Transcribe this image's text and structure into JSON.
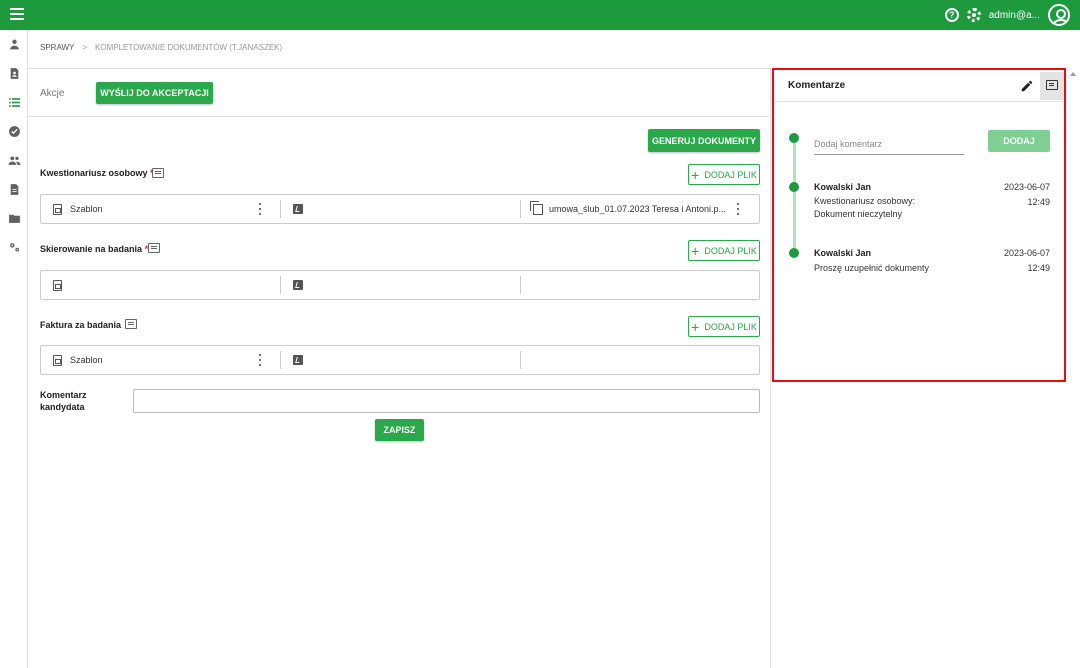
{
  "topbar": {
    "user": "admin@a...",
    "help_icon": "help-circle-icon",
    "settings_icon": "gear-icon",
    "avatar_icon": "account-circle-icon",
    "color": "#1e9a3e"
  },
  "sidebar": {
    "items": [
      {
        "icon": "person-icon"
      },
      {
        "icon": "contact-document-icon"
      },
      {
        "icon": "list-icon",
        "active": true
      },
      {
        "icon": "check-circle-icon"
      },
      {
        "icon": "people-icon"
      },
      {
        "icon": "document-icon"
      },
      {
        "icon": "folder-icon"
      },
      {
        "icon": "settings-cogs-icon"
      }
    ]
  },
  "breadcrumb": {
    "root": "SPRAWY",
    "separator": ">",
    "current": "KOMPLETOWANIE DOKUMENTÓW (T.JANASZEK)"
  },
  "actions": {
    "label": "Akcje",
    "send_button": "WYŚLIJ DO AKCEPTACJI",
    "generate_button": "GENERUJ DOKUMENTY"
  },
  "documents": [
    {
      "title": "Kwestionariusz osobowy",
      "required": "*",
      "add_button": "DODAJ PLIK",
      "template": "Szablon",
      "file": "umowa_ślub_01.07.2023 Teresa i Antoni.p..."
    },
    {
      "title": "Skierowanie na badania",
      "required": "*",
      "add_button": "DODAJ PLIK",
      "template": "",
      "file": ""
    },
    {
      "title": "Faktura za badania",
      "required": "",
      "add_button": "DODAJ PLIK",
      "template": "Szablon",
      "file": ""
    }
  ],
  "candidate_comment": {
    "label": "Komentarz kandydata",
    "value": "",
    "save_button": "ZAPISZ"
  },
  "comments_panel": {
    "title": "Komentarze",
    "input_placeholder": "Dodaj komentarz",
    "add_button": "DODAJ",
    "entries": [
      {
        "author": "Kowalski Jan",
        "text": "Kwestionariusz osobowy: Dokument nieczytelny",
        "date": "2023-06-07",
        "time": "12:49"
      },
      {
        "author": "Kowalski Jan",
        "text": "Proszę uzupełnić dokumenty",
        "date": "2023-06-07",
        "time": "12:49"
      }
    ],
    "highlight_color": "#e01010"
  }
}
